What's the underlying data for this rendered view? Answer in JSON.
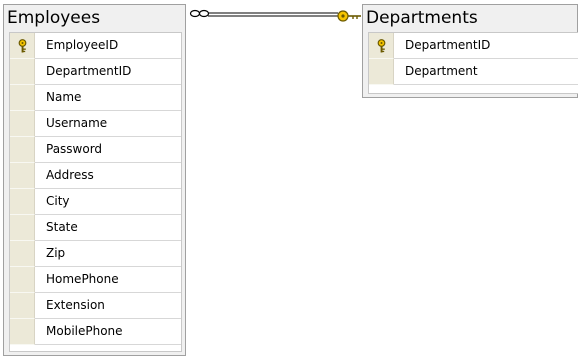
{
  "employees_table": {
    "title": "Employees",
    "columns": [
      {
        "name": "EmployeeID",
        "primary_key": true
      },
      {
        "name": "DepartmentID",
        "primary_key": false
      },
      {
        "name": "Name",
        "primary_key": false
      },
      {
        "name": "Username",
        "primary_key": false
      },
      {
        "name": "Password",
        "primary_key": false
      },
      {
        "name": "Address",
        "primary_key": false
      },
      {
        "name": "City",
        "primary_key": false
      },
      {
        "name": "State",
        "primary_key": false
      },
      {
        "name": "Zip",
        "primary_key": false
      },
      {
        "name": "HomePhone",
        "primary_key": false
      },
      {
        "name": "Extension",
        "primary_key": false
      },
      {
        "name": "MobilePhone",
        "primary_key": false
      }
    ]
  },
  "departments_table": {
    "title": "Departments",
    "columns": [
      {
        "name": "DepartmentID",
        "primary_key": true
      },
      {
        "name": "Department",
        "primary_key": false
      }
    ]
  },
  "relationship": {
    "many_end_icon": "infinity-icon",
    "one_end_icon": "key-icon"
  },
  "colors": {
    "key_gold": "#f5c400",
    "key_outline": "#6b5a00",
    "line": "#000000"
  }
}
